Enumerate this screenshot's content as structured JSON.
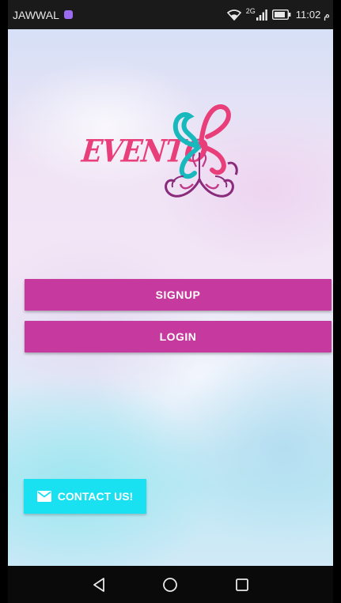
{
  "status_bar": {
    "carrier": "JAWWAL",
    "network": "2G",
    "time": "م 11:02"
  },
  "logo": {
    "text": "EVENTO"
  },
  "buttons": {
    "signup_label": "SIGNUP",
    "login_label": "LOGIN",
    "contact_label": "CONTACT US!"
  },
  "colors": {
    "primary_button": "#c6399e",
    "contact_button": "#19e1f1",
    "logo_pink": "#e83e7a",
    "logo_teal": "#18b9bd",
    "logo_purple": "#8a2a7a"
  },
  "icons": {
    "carrier": "app-notification-icon",
    "wifi": "wifi-icon",
    "signal": "signal-icon",
    "battery": "battery-icon",
    "contact": "mail-icon",
    "nav_back": "back-triangle-icon",
    "nav_home": "home-circle-icon",
    "nav_recent": "recent-square-icon"
  }
}
